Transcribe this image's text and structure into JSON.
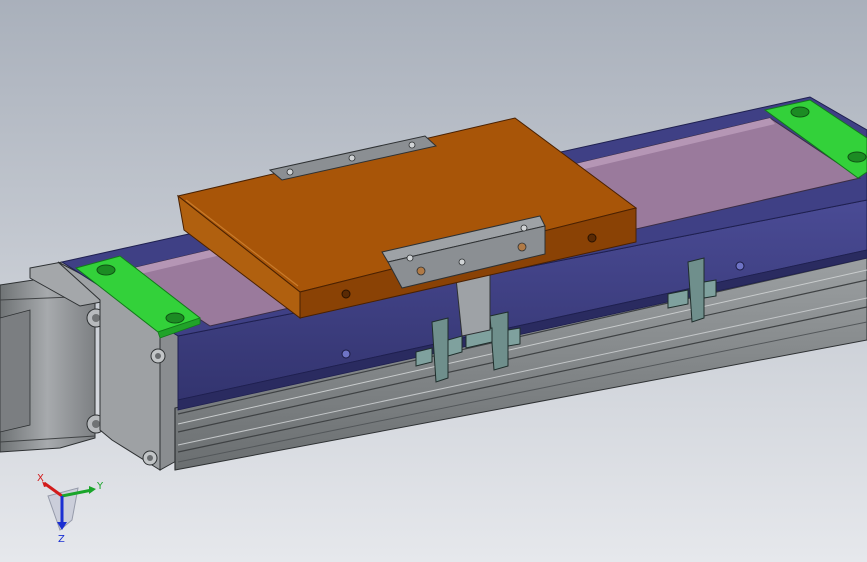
{
  "viewport": {
    "title": "",
    "background_top": "#a9b0bb",
    "background_bottom": "#e6e8ec"
  },
  "colors": {
    "frame_blue": "#3e3f85",
    "frame_blue_dark": "#2c2d66",
    "track_mauve": "#8f6f94",
    "track_mauve_light": "#a686a9",
    "carriage_orange": "#a1510c",
    "carriage_orange_top": "#a85508",
    "carriage_orange_side": "#8a4205",
    "end_pad_green": "#33d13a",
    "end_pad_green_dark": "#21a329",
    "rail_gray": "#8e9294",
    "rail_gray_dark": "#5e6264",
    "motor_gray": "#9a9da0",
    "clamp_plate": "#8b8f93",
    "sensor_teal": "#6f8f8c"
  },
  "triad": {
    "x_label": "X",
    "y_label": "Y",
    "z_label": "Z",
    "x_color": "#d21b1b",
    "y_color": "#1aa52a",
    "z_color": "#1a2fd2",
    "icon": "coordinate-triad-icon"
  }
}
